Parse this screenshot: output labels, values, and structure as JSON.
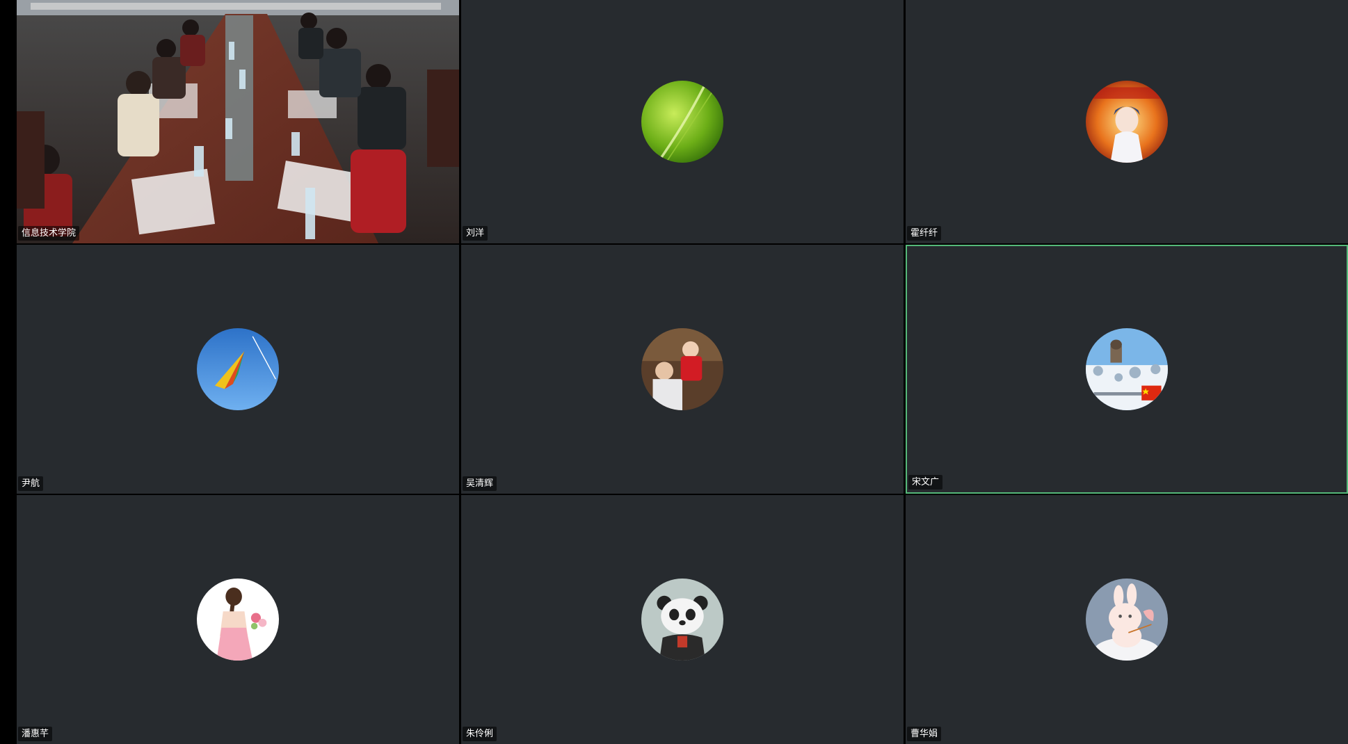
{
  "participants": [
    {
      "name": "信息技术学院",
      "type": "video",
      "active": false
    },
    {
      "name": "刘洋",
      "avatar": "green-leaf-avatar",
      "active": false
    },
    {
      "name": "霍纤纤",
      "avatar": "anime-character-avatar",
      "active": false
    },
    {
      "name": "尹航",
      "avatar": "kite-sky-avatar",
      "active": false
    },
    {
      "name": "吴清辉",
      "avatar": "father-baby-photo-avatar",
      "active": false
    },
    {
      "name": "宋文广",
      "avatar": "snowy-building-flag-avatar",
      "active": true
    },
    {
      "name": "潘惠芊",
      "avatar": "girl-braid-flowers-avatar",
      "active": false
    },
    {
      "name": "朱伶俐",
      "avatar": "panda-cartoon-avatar",
      "active": false
    },
    {
      "name": "曹华娟",
      "avatar": "bunny-cartoon-avatar",
      "active": false
    }
  ],
  "colors": {
    "tile_bg": "#272b2f",
    "active_border": "#55b97a",
    "background": "#000000"
  }
}
